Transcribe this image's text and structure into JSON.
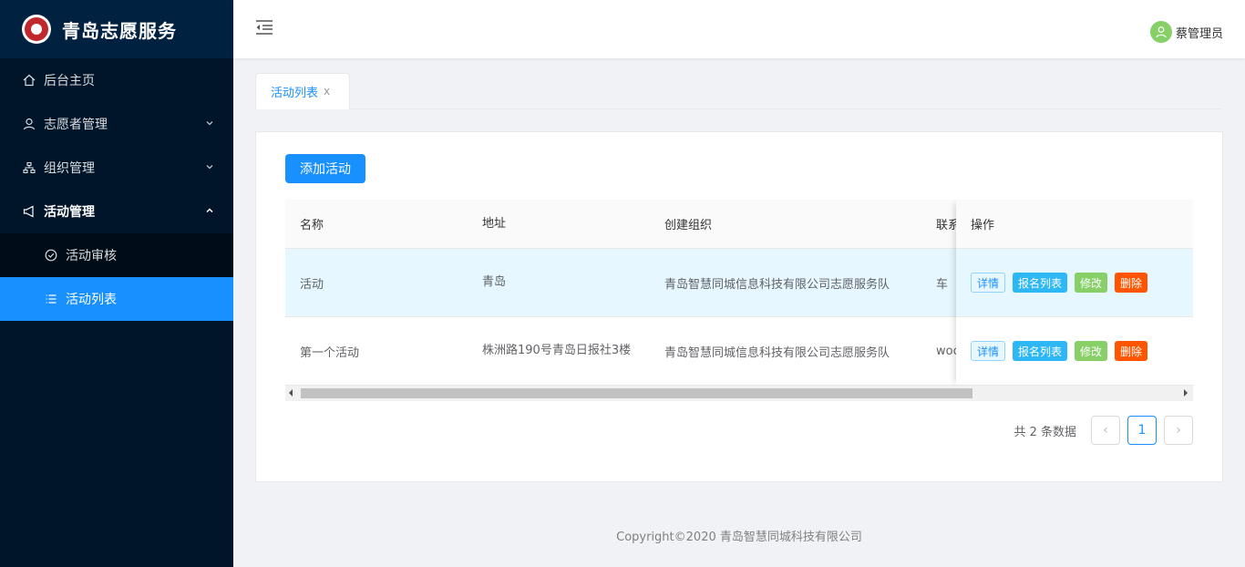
{
  "brand": {
    "title": "青岛志愿服务"
  },
  "sidebar": {
    "items": [
      {
        "label": "后台主页",
        "icon": "home-icon"
      },
      {
        "label": "志愿者管理",
        "icon": "user-icon"
      },
      {
        "label": "组织管理",
        "icon": "org-icon"
      },
      {
        "label": "活动管理",
        "icon": "megaphone-icon"
      }
    ],
    "submenu": [
      {
        "label": "活动审核",
        "icon": "check-circle-icon"
      },
      {
        "label": "活动列表",
        "icon": "list-icon",
        "active": true
      }
    ]
  },
  "header": {
    "user_name": "蔡管理员"
  },
  "tabs": [
    {
      "label": "活动列表",
      "close": "x"
    }
  ],
  "toolbar": {
    "add_label": "添加活动"
  },
  "table": {
    "columns": [
      "名称",
      "地址",
      "创建组织",
      "联系",
      "操作"
    ],
    "rows": [
      {
        "name": "活动",
        "address": "青岛",
        "org": "青岛智慧同城信息科技有限公司志愿服务队",
        "contact": "车"
      },
      {
        "name": "第一个活动",
        "address": "株洲路190号青岛日报社3楼",
        "org": "青岛智慧同城信息科技有限公司志愿服务队",
        "contact": "woo"
      }
    ],
    "actions": {
      "detail": "详情",
      "signup": "报名列表",
      "edit": "修改",
      "delete": "删除"
    }
  },
  "pagination": {
    "total_text": "共 2 条数据",
    "current": "1",
    "prev": "‹",
    "next": "›"
  },
  "footer": {
    "text": "Copyright©2020 青岛智慧同城科技有限公司"
  },
  "colors": {
    "sidebar_bg": "#001529",
    "primary": "#1890ff",
    "signup": "#2db7f5",
    "edit": "#87d068",
    "delete": "#ff5500"
  }
}
